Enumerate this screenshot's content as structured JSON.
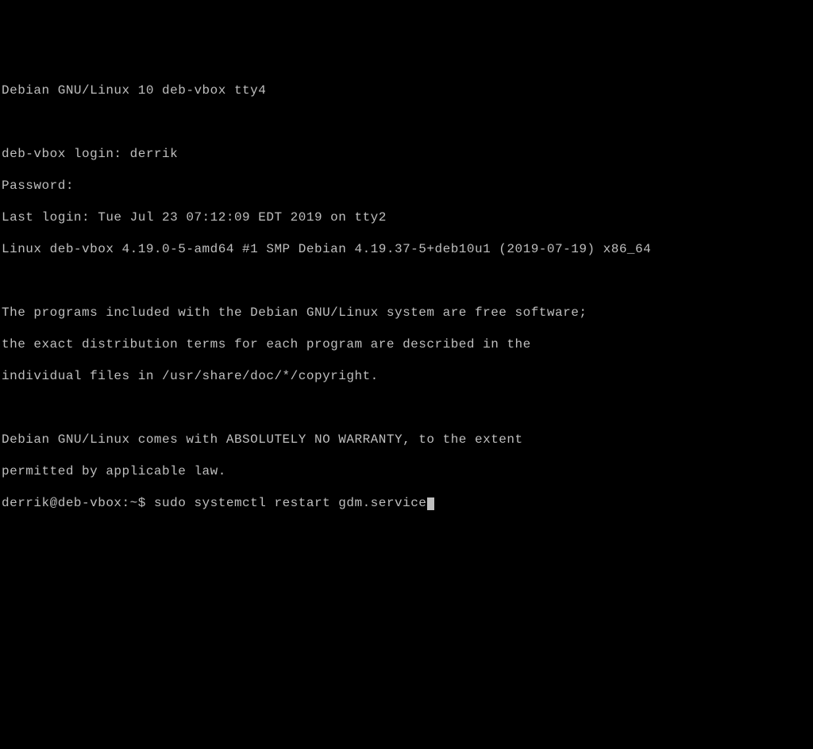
{
  "terminal": {
    "banner": "Debian GNU/Linux 10 deb-vbox tty4",
    "blank1": "",
    "login_prompt": "deb-vbox login: ",
    "login_value": "derrik",
    "password_prompt": "Password:",
    "last_login": "Last login: Tue Jul 23 07:12:09 EDT 2019 on tty2",
    "kernel": "Linux deb-vbox 4.19.0-5-amd64 #1 SMP Debian 4.19.37-5+deb10u1 (2019-07-19) x86_64",
    "blank2": "",
    "motd1": "The programs included with the Debian GNU/Linux system are free software;",
    "motd2": "the exact distribution terms for each program are described in the",
    "motd3": "individual files in /usr/share/doc/*/copyright.",
    "blank3": "",
    "motd4": "Debian GNU/Linux comes with ABSOLUTELY NO WARRANTY, to the extent",
    "motd5": "permitted by applicable law.",
    "prompt": "derrik@deb-vbox:~$ ",
    "command": "sudo systemctl restart gdm.service"
  }
}
